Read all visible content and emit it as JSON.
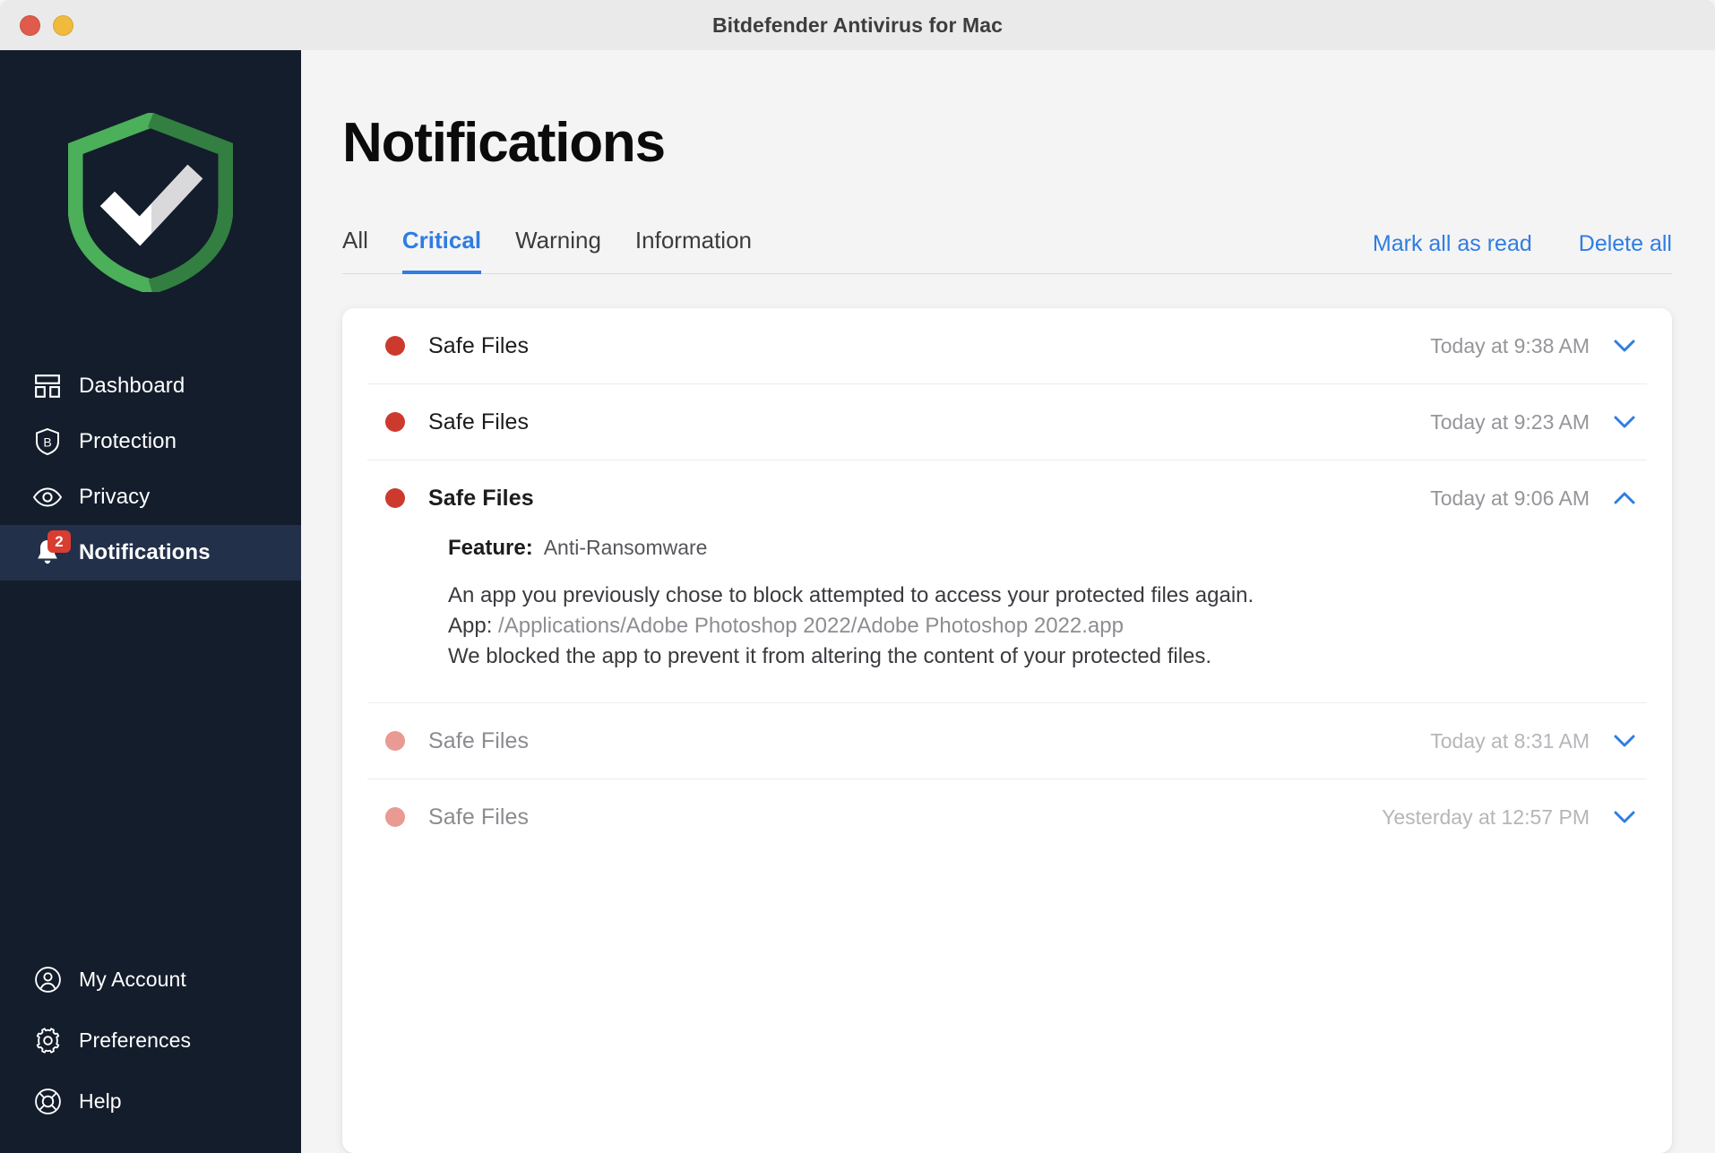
{
  "window": {
    "title": "Bitdefender Antivirus for Mac",
    "traffic_lights": [
      {
        "name": "close",
        "color": "#e05b4c"
      },
      {
        "name": "minimize",
        "color": "#f0ba3d"
      }
    ]
  },
  "sidebar": {
    "logo": {
      "icon": "shield-check-logo",
      "color_light": "#4caf5a",
      "color_dark": "#2f7a3e"
    },
    "primary_items": [
      {
        "id": "dashboard",
        "label": "Dashboard",
        "icon": "layout-grid-icon",
        "active": false,
        "badge": null
      },
      {
        "id": "protection",
        "label": "Protection",
        "icon": "shield-b-icon",
        "active": false,
        "badge": null
      },
      {
        "id": "privacy",
        "label": "Privacy",
        "icon": "eye-icon",
        "active": false,
        "badge": null
      },
      {
        "id": "notifications",
        "label": "Notifications",
        "icon": "bell-icon",
        "active": true,
        "badge": "2"
      }
    ],
    "secondary_items": [
      {
        "id": "my-account",
        "label": "My Account",
        "icon": "user-circle-icon"
      },
      {
        "id": "preferences",
        "label": "Preferences",
        "icon": "gear-icon"
      },
      {
        "id": "help",
        "label": "Help",
        "icon": "lifebuoy-icon"
      }
    ],
    "badge_color": "#d93c31",
    "background": "#141d2b",
    "active_background": "#22304a"
  },
  "main": {
    "page_title": "Notifications",
    "tabs": [
      {
        "id": "all",
        "label": "All",
        "active": false
      },
      {
        "id": "critical",
        "label": "Critical",
        "active": true
      },
      {
        "id": "warning",
        "label": "Warning",
        "active": false
      },
      {
        "id": "information",
        "label": "Information",
        "active": false
      }
    ],
    "actions": [
      {
        "id": "mark-all-read",
        "label": "Mark all as read"
      },
      {
        "id": "delete-all",
        "label": "Delete all"
      }
    ],
    "accent_color": "#2f7de1",
    "notifications": [
      {
        "title": "Safe Files",
        "time": "Today at 9:38 AM",
        "severity": "critical",
        "read": false,
        "expanded": false,
        "chevron": "chevron-down-icon"
      },
      {
        "title": "Safe Files",
        "time": "Today at 9:23 AM",
        "severity": "critical",
        "read": false,
        "expanded": false,
        "chevron": "chevron-down-icon"
      },
      {
        "title": "Safe Files",
        "time": "Today at 9:06 AM",
        "severity": "critical",
        "read": false,
        "expanded": true,
        "chevron": "chevron-up-icon",
        "details": {
          "feature_label": "Feature:",
          "feature_value": "Anti-Ransomware",
          "line1": "An app you previously chose to block attempted to access your protected files again.",
          "app_label": "App:",
          "app_path": "/Applications/Adobe Photoshop 2022/Adobe Photoshop 2022.app",
          "line3": "We blocked the app to prevent it from altering the content of your protected files."
        }
      },
      {
        "title": "Safe Files",
        "time": "Today at 8:31 AM",
        "severity": "critical",
        "read": true,
        "expanded": false,
        "chevron": "chevron-down-icon"
      },
      {
        "title": "Safe Files",
        "time": "Yesterday at 12:57 PM",
        "severity": "critical",
        "read": true,
        "expanded": false,
        "chevron": "chevron-down-icon"
      }
    ],
    "dot_colors": {
      "unread": "#cc3a2e",
      "read": "#e89a93"
    }
  }
}
